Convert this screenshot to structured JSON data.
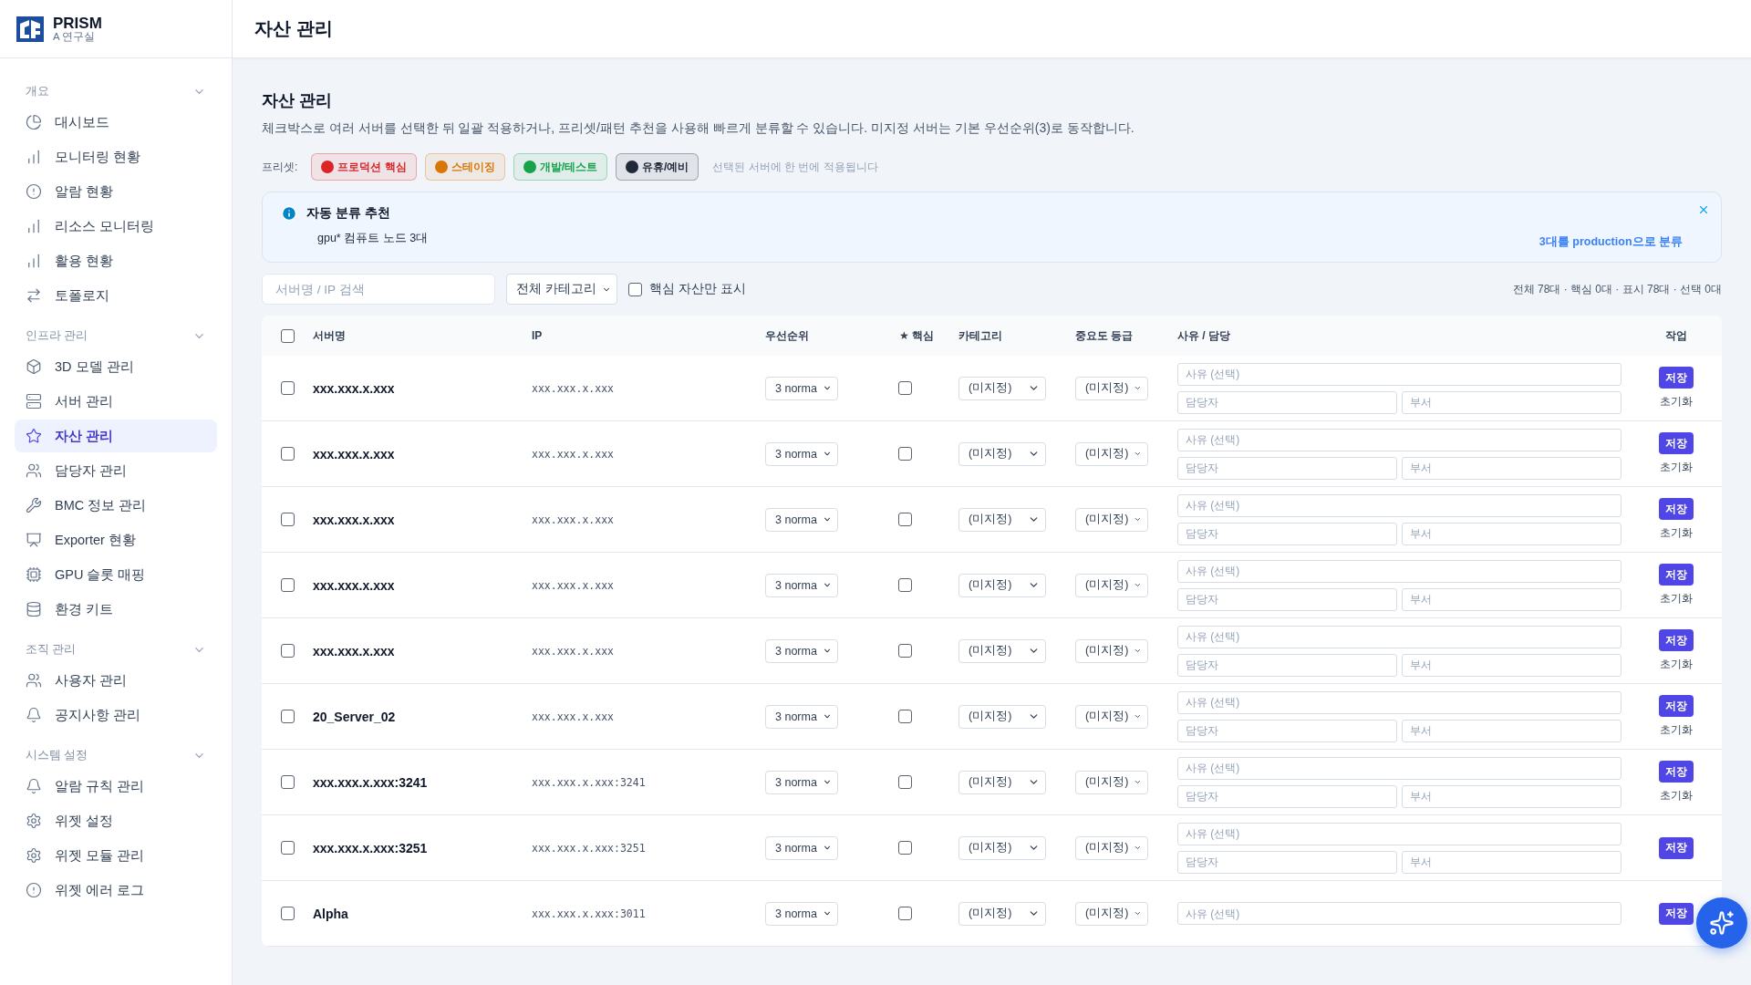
{
  "brand": {
    "name": "PRISM",
    "subtitle": "A 연구실"
  },
  "sidebar": {
    "sections": [
      {
        "title": "개요",
        "expanded": true,
        "items": [
          {
            "label": "대시보드",
            "selected": false
          },
          {
            "label": "모니터링 현황",
            "selected": false
          },
          {
            "label": "알람 현황",
            "selected": false
          },
          {
            "label": "리소스 모니터링",
            "selected": false
          },
          {
            "label": "활용 현황",
            "selected": false
          },
          {
            "label": "토폴로지",
            "selected": false
          }
        ]
      },
      {
        "title": "인프라 관리",
        "expanded": true,
        "items": [
          {
            "label": "3D 모델 관리",
            "selected": false
          },
          {
            "label": "서버 관리",
            "selected": false
          },
          {
            "label": "자산 관리",
            "selected": true
          },
          {
            "label": "담당자 관리",
            "selected": false
          },
          {
            "label": "BMC 정보 관리",
            "selected": false
          },
          {
            "label": "Exporter 현황",
            "selected": false
          },
          {
            "label": "GPU 슬롯 매핑",
            "selected": false
          },
          {
            "label": "환경 키트",
            "selected": false
          }
        ]
      },
      {
        "title": "조직 관리",
        "expanded": true,
        "items": [
          {
            "label": "사용자 관리",
            "selected": false
          },
          {
            "label": "공지사항 관리",
            "selected": false
          }
        ]
      },
      {
        "title": "시스템 설정",
        "expanded": true,
        "items": [
          {
            "label": "알람 규칙 관리",
            "selected": false
          },
          {
            "label": "위젯 설정",
            "selected": false
          },
          {
            "label": "위젯 모듈 관리",
            "selected": false
          },
          {
            "label": "위젯 에러 로그",
            "selected": false
          }
        ]
      }
    ]
  },
  "header": {
    "title": "자산 관리"
  },
  "page": {
    "title": "자산 관리",
    "description": "체크박스로 여러 서버를 선택한 뒤 일괄 적용하거나, 프리셋/패턴 추천을 사용해 빠르게 분류할 수 있습니다. 미지정 서버는 기본 우선순위(3)로 동작합니다."
  },
  "presets": {
    "label": "프리셋:",
    "hint": "선택된 서버에 한 번에 적용됩니다",
    "items": [
      {
        "label": "프로덕션 핵심",
        "color": "#dc2626"
      },
      {
        "label": "스테이징",
        "color": "#d97706"
      },
      {
        "label": "개발/테스트",
        "color": "#16a34a"
      },
      {
        "label": "유휴/예비",
        "color": "#1f2937"
      }
    ]
  },
  "suggestion": {
    "title": "자동 분류 추천",
    "text": "gpu* 컴퓨트 노드 3대",
    "action": "3대를 production으로 분류"
  },
  "filters": {
    "search_placeholder": "서버명 / IP 검색",
    "category": "전체 카테고리",
    "core_only": {
      "label": "핵심 자산만 표시",
      "checked": false
    },
    "summary": "전체 78대 · 핵심 0대 · 표시 78대 · 선택 0대"
  },
  "table": {
    "select_all": false,
    "columns": [
      "서버명",
      "IP",
      "우선순위",
      "★ 핵심",
      "카테고리",
      "중요도 등급",
      "사유 / 담당",
      "작업"
    ],
    "rows": [
      {
        "selected": false,
        "name": "xxx.xxx.x.xxx",
        "ip": "xxx.xxx.x.xxx",
        "priority": "3 norma",
        "core": false,
        "category": "(미지정)",
        "grade": "(미지정)",
        "reason_placeholder": "사유 (선택)",
        "owner_placeholder": "담당자",
        "dept_placeholder": "부서",
        "save": "저장",
        "reset": "초기화"
      },
      {
        "selected": false,
        "name": "xxx.xxx.x.xxx",
        "ip": "xxx.xxx.x.xxx",
        "priority": "3 norma",
        "core": false,
        "category": "(미지정)",
        "grade": "(미지정)",
        "reason_placeholder": "사유 (선택)",
        "owner_placeholder": "담당자",
        "dept_placeholder": "부서",
        "save": "저장",
        "reset": "초기화"
      },
      {
        "selected": false,
        "name": "xxx.xxx.x.xxx",
        "ip": "xxx.xxx.x.xxx",
        "priority": "3 norma",
        "core": false,
        "category": "(미지정)",
        "grade": "(미지정)",
        "reason_placeholder": "사유 (선택)",
        "owner_placeholder": "담당자",
        "dept_placeholder": "부서",
        "save": "저장",
        "reset": "초기화"
      },
      {
        "selected": false,
        "name": "xxx.xxx.x.xxx",
        "ip": "xxx.xxx.x.xxx",
        "priority": "3 norma",
        "core": false,
        "category": "(미지정)",
        "grade": "(미지정)",
        "reason_placeholder": "사유 (선택)",
        "owner_placeholder": "담당자",
        "dept_placeholder": "부서",
        "save": "저장",
        "reset": "초기화"
      },
      {
        "selected": false,
        "name": "xxx.xxx.x.xxx",
        "ip": "xxx.xxx.x.xxx",
        "priority": "3 norma",
        "core": false,
        "category": "(미지정)",
        "grade": "(미지정)",
        "reason_placeholder": "사유 (선택)",
        "owner_placeholder": "담당자",
        "dept_placeholder": "부서",
        "save": "저장",
        "reset": "초기화"
      },
      {
        "selected": false,
        "name": "20_Server_02",
        "ip": "xxx.xxx.x.xxx",
        "priority": "3 norma",
        "core": false,
        "category": "(미지정)",
        "grade": "(미지정)",
        "reason_placeholder": "사유 (선택)",
        "owner_placeholder": "담당자",
        "dept_placeholder": "부서",
        "save": "저장",
        "reset": "초기화"
      },
      {
        "selected": false,
        "name": "xxx.xxx.x.xxx:3241",
        "ip": "xxx.xxx.x.xxx:3241",
        "priority": "3 norma",
        "core": false,
        "category": "(미지정)",
        "grade": "(미지정)",
        "reason_placeholder": "사유 (선택)",
        "owner_placeholder": "담당자",
        "dept_placeholder": "부서",
        "save": "저장",
        "reset": "초기화"
      },
      {
        "selected": false,
        "name": "xxx.xxx.x.xxx:3251",
        "ip": "xxx.xxx.x.xxx:3251",
        "priority": "3 norma",
        "core": false,
        "category": "(미지정)",
        "grade": "(미지정)",
        "reason_placeholder": "사유 (선택)",
        "owner_placeholder": "담당자",
        "dept_placeholder": "부서",
        "save": "저장"
      },
      {
        "selected": false,
        "name": "Alpha",
        "ip": "xxx.xxx.x.xxx:3011",
        "priority": "3 norma",
        "core": false,
        "category": "(미지정)",
        "grade": "(미지정)",
        "reason_placeholder": "사유 (선택)",
        "save": "저장"
      }
    ]
  }
}
